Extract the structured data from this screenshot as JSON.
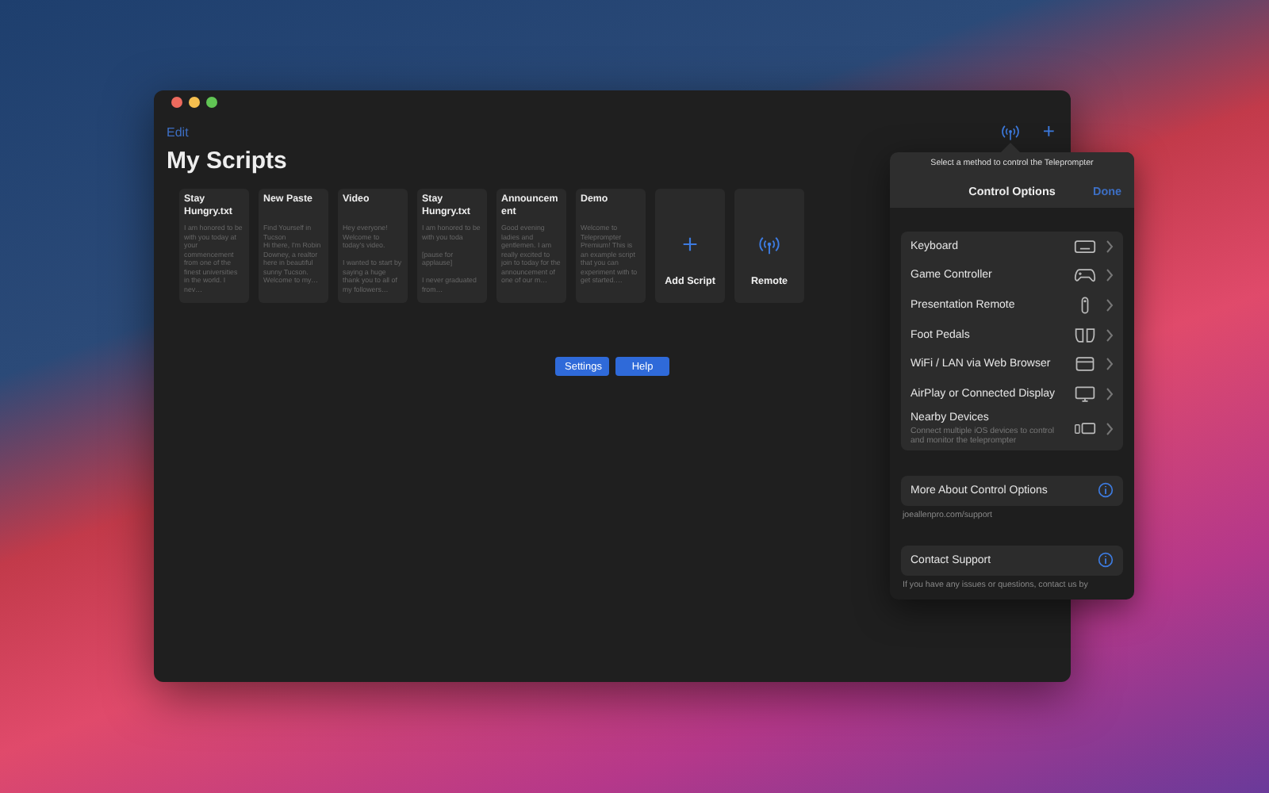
{
  "window": {
    "edit_label": "Edit",
    "add_label": "+",
    "title": "My Scripts"
  },
  "cards": [
    {
      "kind": "script",
      "title": "Stay Hungry.txt",
      "preview": "I am honored to be with you today at your commencement from one of the finest universities in the world. I nev…"
    },
    {
      "kind": "script",
      "title": "New Paste",
      "preview": "Find Yourself in Tucson\nHi there, I'm Robin Downey, a realtor here in beautiful sunny Tucson. Welcome to my…"
    },
    {
      "kind": "script",
      "title": "Video",
      "preview": "Hey everyone! Welcome to today's video.\n\nI wanted to start by saying a huge thank you to all of my followers…"
    },
    {
      "kind": "script",
      "title": "Stay Hungry.txt",
      "preview": "I am honored to be with you toda\n\n[pause for applause]\n\nI never graduated from…"
    },
    {
      "kind": "script",
      "title": "Announcement",
      "preview": "Good evening ladies and gentlemen. I am really excited to join to today for the announcement of one of our m…"
    },
    {
      "kind": "script",
      "title": "Demo",
      "preview": "Welcome to Teleprompter Premium! This is an example script that you can experiment with to get started.…"
    },
    {
      "kind": "add",
      "title": "Add Script"
    },
    {
      "kind": "remote",
      "title": "Remote"
    }
  ],
  "buttons": [
    "Settings",
    "Help"
  ],
  "popover": {
    "hint": "Select a method to control the Teleprompter",
    "title": "Control Options",
    "done": "Done",
    "options": [
      {
        "kind": "keyboard",
        "label": "Keyboard"
      },
      {
        "kind": "gamepad",
        "label": "Game Controller"
      },
      {
        "kind": "remote",
        "label": "Presentation Remote"
      },
      {
        "kind": "pedals",
        "label": "Foot Pedals"
      },
      {
        "kind": "browser",
        "label": "WiFi / LAN via Web Browser"
      },
      {
        "kind": "display",
        "label": "AirPlay or Connected Display"
      },
      {
        "kind": "devices",
        "label": "Nearby Devices",
        "subtitle": "Connect multiple iOS devices to control and monitor the teleprompter"
      }
    ],
    "more": {
      "label": "More About Control Options",
      "link": "joeallenpro.com/support"
    },
    "contact": {
      "label": "Contact Support",
      "footer": "If you have any issues or questions, contact us by"
    }
  }
}
